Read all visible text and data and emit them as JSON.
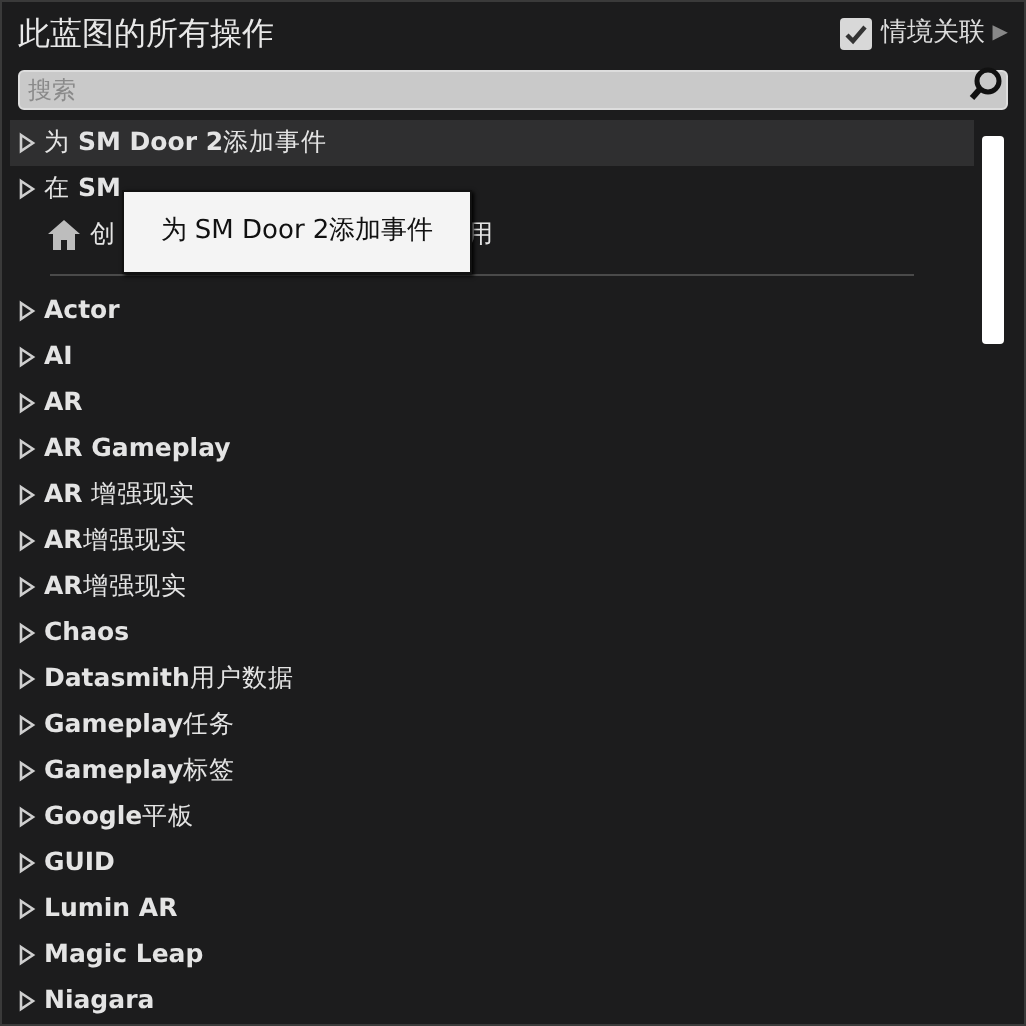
{
  "title": "此蓝图的所有操作",
  "context_toggle": {
    "label": "情境关联",
    "checked": true,
    "arrow": "▶"
  },
  "search": {
    "placeholder": "搜索"
  },
  "top_items": [
    {
      "kind": "expandable",
      "text": "为 **SM Door 2**添加事件",
      "selected": true
    },
    {
      "kind": "expandable",
      "text": "在 **SM**",
      "selected": false
    },
    {
      "kind": "home",
      "text": "创",
      "text_after": "用",
      "selected": false
    }
  ],
  "categories": [
    {
      "text": "**Actor**"
    },
    {
      "text": "**AI**"
    },
    {
      "text": "**AR**"
    },
    {
      "text": "**AR Gameplay**"
    },
    {
      "text": "**AR** 增强现实"
    },
    {
      "text": "**AR**增强现实"
    },
    {
      "text": "**AR**增强现实"
    },
    {
      "text": "**Chaos**"
    },
    {
      "text": "**Datasmith**用户数据"
    },
    {
      "text": "**Gameplay**任务"
    },
    {
      "text": "**Gameplay**标签"
    },
    {
      "text": "**Google**平板"
    },
    {
      "text": "**GUID**"
    },
    {
      "text": "**Lumin AR**"
    },
    {
      "text": "**Magic Leap**"
    },
    {
      "text": "**Niagara**"
    }
  ],
  "tooltip": {
    "text": "为 SM Door 2添加事件"
  }
}
